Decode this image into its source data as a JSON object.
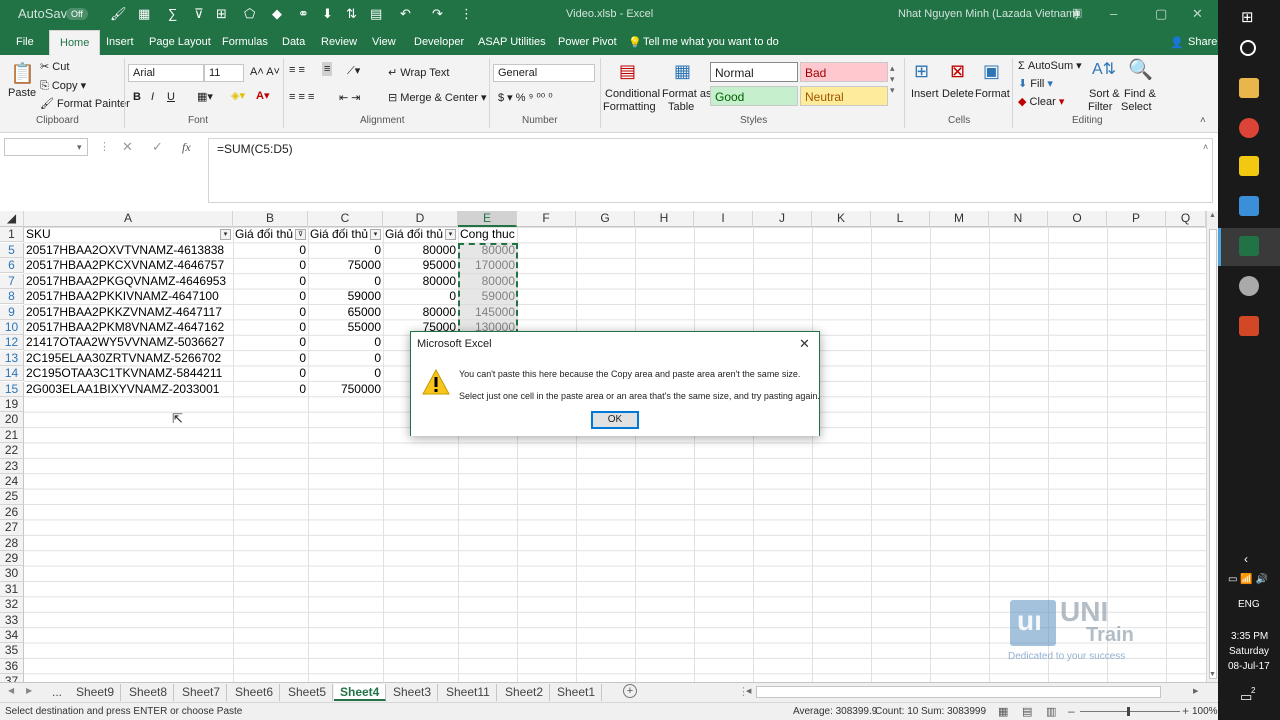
{
  "window": {
    "autosave": "AutoSave",
    "autosave_state": "Off",
    "title": "Video.xlsb  -  Excel",
    "user": "Nhat Nguyen Minh (Lazada Vietnam)"
  },
  "tabs": [
    "File",
    "Home",
    "Insert",
    "Page Layout",
    "Formulas",
    "Data",
    "Review",
    "View",
    "Developer",
    "ASAP Utilities",
    "Power Pivot"
  ],
  "tell_me": "Tell me what you want to do",
  "share": "Share",
  "ribbon": {
    "clipboard": {
      "paste": "Paste",
      "cut": "Cut",
      "copy": "Copy",
      "format_painter": "Format Painter",
      "label": "Clipboard"
    },
    "font": {
      "name": "Arial",
      "size": "11",
      "bold": "B",
      "italic": "I",
      "underline": "U",
      "label": "Font"
    },
    "alignment": {
      "wrap": "Wrap Text",
      "merge": "Merge & Center",
      "label": "Alignment"
    },
    "number": {
      "format": "General",
      "label": "Number"
    },
    "styles": {
      "conditional": "Conditional",
      "formatting": "Formatting",
      "format_as": "Format as",
      "table": "Table",
      "normal": "Normal",
      "bad": "Bad",
      "good": "Good",
      "neutral": "Neutral",
      "label": "Styles"
    },
    "cells": {
      "insert": "Insert",
      "delete": "Delete",
      "format": "Format",
      "label": "Cells"
    },
    "editing": {
      "autosum": "AutoSum",
      "fill": "Fill",
      "clear": "Clear",
      "sort": "Sort &",
      "filter": "Filter",
      "find": "Find &",
      "select": "Select",
      "label": "Editing"
    }
  },
  "formula": {
    "namebox": "",
    "fx": "fx",
    "value": "=SUM(C5:D5)"
  },
  "columns": [
    "A",
    "B",
    "C",
    "D",
    "E",
    "F",
    "G",
    "H",
    "I",
    "J",
    "K",
    "L",
    "M",
    "N",
    "O",
    "P",
    "Q"
  ],
  "header_row": {
    "row": "1",
    "A": "SKU",
    "B": "Giá đối thủ",
    "C": "Giá đối thủ",
    "D": "Giá đối thủ",
    "E": "Cong thuc"
  },
  "rows": [
    {
      "row": "5",
      "A": "20517HBAA2OXVTVNAMZ-4613838",
      "B": "0",
      "C": "0",
      "D": "80000",
      "E": "80000"
    },
    {
      "row": "6",
      "A": "20517HBAA2PKCXVNAMZ-4646757",
      "B": "0",
      "C": "75000",
      "D": "95000",
      "E": "170000"
    },
    {
      "row": "7",
      "A": "20517HBAA2PKGQVNAMZ-4646953",
      "B": "0",
      "C": "0",
      "D": "80000",
      "E": "80000"
    },
    {
      "row": "8",
      "A": "20517HBAA2PKKIVNAMZ-4647100",
      "B": "0",
      "C": "59000",
      "D": "0",
      "E": "59000"
    },
    {
      "row": "9",
      "A": "20517HBAA2PKKZVNAMZ-4647117",
      "B": "0",
      "C": "65000",
      "D": "80000",
      "E": "145000"
    },
    {
      "row": "10",
      "A": "20517HBAA2PKM8VNAMZ-4647162",
      "B": "0",
      "C": "55000",
      "D": "75000",
      "E": "130000"
    },
    {
      "row": "12",
      "A": "21417OTAA2WY5VVNAMZ-5036627",
      "B": "0",
      "C": "0",
      "D": "",
      "E": ""
    },
    {
      "row": "13",
      "A": "2C195ELAA30ZRTVNAMZ-5266702",
      "B": "0",
      "C": "0",
      "D": "",
      "E": ""
    },
    {
      "row": "14",
      "A": "2C195OTAA3C1TKVNAMZ-5844211",
      "B": "0",
      "C": "0",
      "D": "",
      "E": ""
    },
    {
      "row": "15",
      "A": "2G003ELAA1BIXYVNAMZ-2033001",
      "B": "0",
      "C": "750000",
      "D": "",
      "E": ""
    }
  ],
  "empty_rows": [
    "19",
    "20",
    "21",
    "22",
    "23",
    "24",
    "25",
    "26",
    "27",
    "28",
    "29",
    "30",
    "31",
    "32",
    "33",
    "34",
    "35",
    "36",
    "37"
  ],
  "sheets": [
    "...",
    "Sheet9",
    "Sheet8",
    "Sheet7",
    "Sheet6",
    "Sheet5",
    "Sheet4",
    "Sheet3",
    "Sheet11",
    "Sheet2",
    "Sheet1"
  ],
  "active_sheet": "Sheet4",
  "status": {
    "message": "Select destination and press ENTER or choose Paste",
    "average": "Average: 308399.9",
    "count": "Count: 10",
    "sum": "Sum: 3083999",
    "zoom": "100%"
  },
  "dialog": {
    "title": "Microsoft Excel",
    "line1": "You can't paste this here because the Copy area and paste area aren't the same size.",
    "line2": "Select just one cell in the paste area or an area that's the same size, and try pasting again.",
    "ok": "OK"
  },
  "watermark": {
    "brand": "UNI",
    "brand2": "Train",
    "tagline": "Dedicated to your success"
  },
  "taskbar": {
    "lang": "ENG",
    "time": "3:35 PM",
    "day": "Saturday",
    "date": "08-Jul-17",
    "notif": "2"
  },
  "colors": {
    "excel_green": "#217346",
    "bad_bg": "#ffc7ce",
    "good_bg": "#c6efce",
    "neutral_bg": "#ffeb9c"
  }
}
